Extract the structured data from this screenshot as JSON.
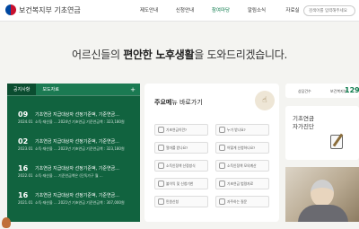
{
  "header": {
    "logo_text": "보건복지부 기초연금",
    "nav": [
      "제도안내",
      "신청안내",
      "참여마당",
      "알림소식",
      "자료실"
    ],
    "search_placeholder": "검색어를 입력해주세요"
  },
  "hero": {
    "prefix": "어르신들의 ",
    "emphasis": "편안한 노후생활",
    "suffix": "을 도와드리겠습니다."
  },
  "notice": {
    "tabs": [
      "공지사항",
      "보도자료"
    ],
    "more": "+",
    "items": [
      {
        "day": "09",
        "date": "2024.01",
        "title": "기초연금 지급대상자 선정기준액, 기준연금...",
        "sub": "소득·재산을 ... 2024년 기초연금 기준연금액 : 323,180원"
      },
      {
        "day": "02",
        "date": "2023.01",
        "title": "기초연금 지급대상자 선정기준액, 기준연금...",
        "sub": "소득·재산을 ... 2023년 기초연금 기준연금액 : 323,180원"
      },
      {
        "day": "16",
        "date": "2022.01",
        "title": "기초연금 지급대상자 선정기준액, 기준연금...",
        "sub": "소득·재산을 ... 기준연금액은 (단독가구 월 ..."
      },
      {
        "day": "16",
        "date": "2021.01",
        "title": "기초연금 지급대상자 선정기준액, 기준연금...",
        "sub": "소득·재산을 ... 2021년 기초연금 기준연금액 : 307,000원"
      }
    ]
  },
  "menu": {
    "title_bold": "주요메",
    "title_rest": "뉴 바로가기",
    "buttons": [
      "기초연금이란?",
      "누가 받나요?",
      "얼마를 받나요?",
      "어떻게 신청하나요?",
      "소득인정액 산정방식",
      "소득인정액 모의계산",
      "불이익 및 신청기한",
      "기초연금 법령자료",
      "민원신청",
      "자주하는 질문"
    ]
  },
  "stats": {
    "label1": "상담건수",
    "label2": "보건복지부",
    "value": "129"
  },
  "selfcheck": {
    "line1": "기초연금",
    "line2": "자가진단"
  },
  "colors": {
    "notice_bg": "#11633f",
    "accent": "#0b7a4b"
  }
}
